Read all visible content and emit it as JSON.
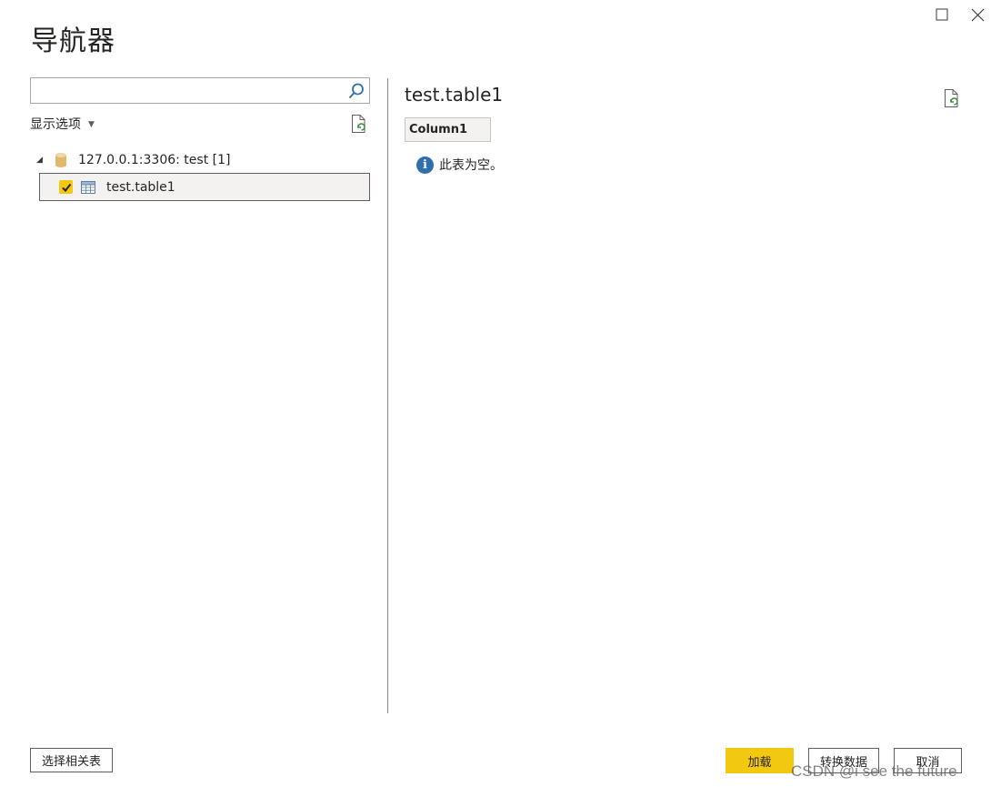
{
  "window": {
    "title": "导航器",
    "maximize_icon": "maximize-icon",
    "close_icon": "close-icon"
  },
  "left_pane": {
    "search": {
      "value": "",
      "placeholder": "",
      "icon": "search-icon"
    },
    "display_options_label": "显示选项",
    "refresh_icon": "refresh-document-icon",
    "tree": {
      "server": {
        "label": "127.0.0.1:3306: test [1]",
        "icon": "database-icon",
        "expanded": true
      },
      "items": [
        {
          "label": "test.table1",
          "checked": true,
          "selected": true,
          "icon": "table-icon"
        }
      ]
    }
  },
  "preview": {
    "title": "test.table1",
    "refresh_icon": "refresh-document-icon",
    "columns": [
      "Column1"
    ],
    "empty_message": "此表为空。",
    "info_icon": "info-icon"
  },
  "footer": {
    "select_related_label": "选择相关表",
    "load_label": "加载",
    "transform_label": "转换数据",
    "cancel_label": "取消"
  },
  "watermark": "CSDN @i see the future",
  "colors": {
    "accent": "#f2c811",
    "info": "#2e6fac",
    "border": "#605e5c"
  }
}
